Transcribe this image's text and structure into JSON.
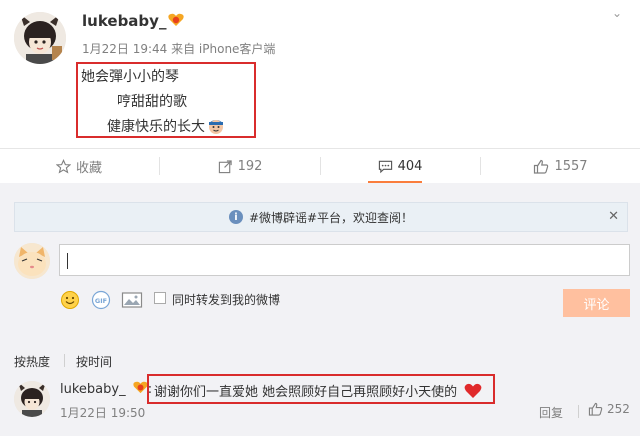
{
  "post": {
    "user": "lukebaby_",
    "meta": "1月22日 19:44 来自 iPhone客户端",
    "lines": [
      "她会彈小小的琴",
      "哼甜甜的歌",
      "健康快乐的长大"
    ]
  },
  "actions": {
    "favorite": "收藏",
    "repost": "192",
    "comment": "404",
    "like": "1557"
  },
  "notice": "#微博辟谣#平台，欢迎查阅！",
  "composer": {
    "sync_label": "同时转发到我的微博",
    "submit": "评论"
  },
  "sort": {
    "hot": "按热度",
    "time": "按时间"
  },
  "comment": {
    "user": "lukebaby_",
    "colon": ":",
    "text": "谢谢你们一直爱她 她会照顾好自己再照顾好小天使的",
    "time": "1月22日 19:50",
    "reply": "回复",
    "likes": "252"
  },
  "colors": {
    "accent": "#fa7d3c",
    "highlight_box": "#d92c2c",
    "submit_disabled": "#ffc09f"
  }
}
